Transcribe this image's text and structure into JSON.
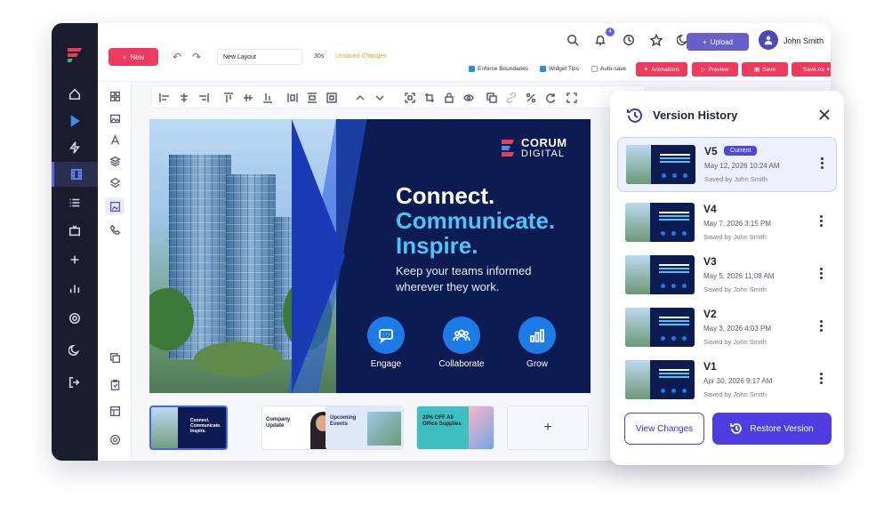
{
  "toolbar": {
    "new_label": "New",
    "layout_name": "New Layout",
    "duration": "30s",
    "unsaved": "Unsaved Changes",
    "notification_count": "4",
    "upload_label": "Upload",
    "user_name": "John Smith",
    "checkboxes": [
      {
        "label": "Enforce Boundaries",
        "checked": true
      },
      {
        "label": "Widget Tips",
        "checked": true
      },
      {
        "label": "Auto-save",
        "checked": false
      }
    ],
    "animations_label": "Animations",
    "preview_label": "Preview",
    "save_label": "Save",
    "save_as_label": "Save As",
    "accent_red": "#ee3a5d",
    "accent_purple": "#6a5fc8"
  },
  "slide": {
    "brand_line1": "CORUM",
    "brand_line2": "DIGITAL",
    "headline_1": "Connect.",
    "headline_2": "Communicate.",
    "headline_3": "Inspire.",
    "subline": "Keep your teams informed wherever they work.",
    "features": [
      {
        "label": "Engage",
        "icon": "chat-icon"
      },
      {
        "label": "Collaborate",
        "icon": "people-icon"
      },
      {
        "label": "Grow",
        "icon": "bar-chart-icon"
      }
    ]
  },
  "thumbnails": [
    {
      "title": "Connect. Communicate. Inspire."
    },
    {
      "title": "Company Update"
    },
    {
      "title": "Upcoming Events"
    },
    {
      "title": "20% OFF All Office Supplies"
    }
  ],
  "version_history": {
    "title": "Version History",
    "versions": [
      {
        "name": "V5",
        "badge": "Current",
        "date": "May 12, 2026   10:24 AM",
        "by": "Saved by John Smith"
      },
      {
        "name": "V4",
        "date": "May 7, 2026   3:15 PM",
        "by": "Saved by John Smith"
      },
      {
        "name": "V3",
        "date": "May 5, 2026   11:08 AM",
        "by": "Saved by John Smith"
      },
      {
        "name": "V2",
        "date": "May 3, 2026   4:03 PM",
        "by": "Saved by John Smith"
      },
      {
        "name": "V1",
        "date": "Apr 30, 2026   9:17 AM",
        "by": "Saved by John Smith"
      }
    ],
    "view_changes_label": "View Changes",
    "restore_label": "Restore Version"
  }
}
